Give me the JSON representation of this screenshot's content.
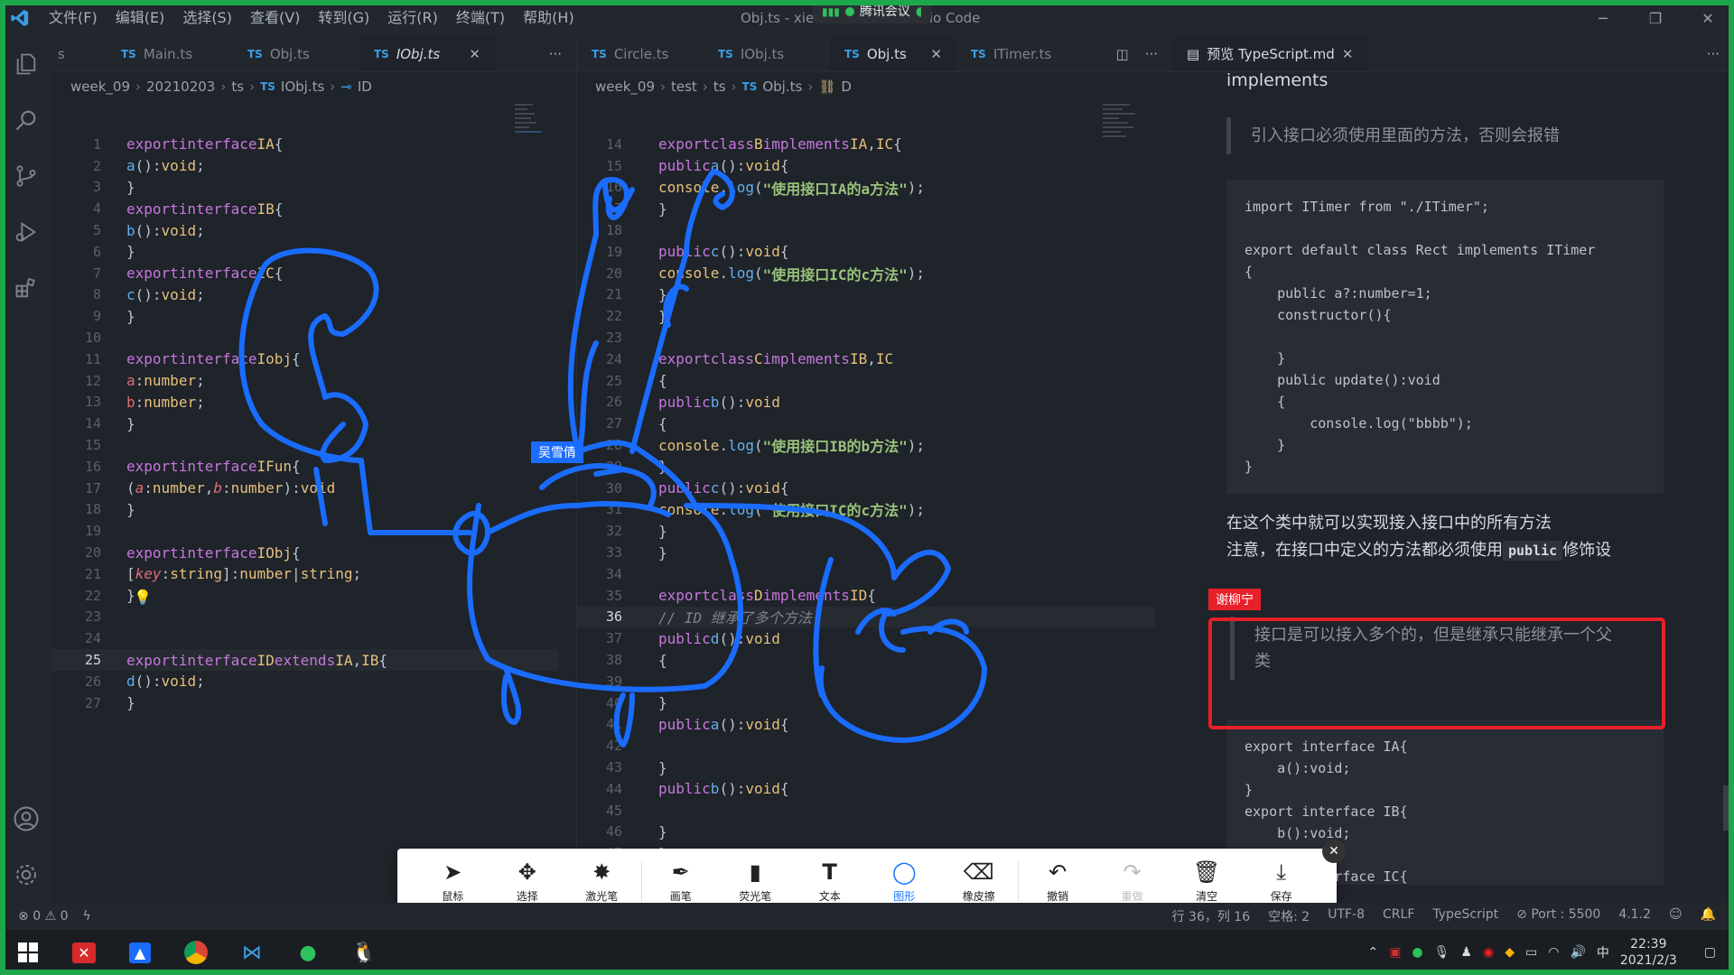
{
  "titlebar": {
    "menu": [
      "文件(F)",
      "编辑(E)",
      "选择(S)",
      "查看(V)",
      "转到(G)",
      "运行(R)",
      "终端(T)",
      "帮助(H)"
    ],
    "title": "Obj.ts - xietian - Visual Studio Code",
    "meeting": "腾讯会议"
  },
  "pane1": {
    "tabs": [
      {
        "label": "Main.ts",
        "active": false
      },
      {
        "label": "Obj.ts",
        "active": false
      },
      {
        "label": "IObj.ts",
        "active": true
      }
    ],
    "crumbs": [
      "week_09",
      "20210203",
      "ts",
      "IObj.ts",
      "ID"
    ],
    "current_line": 25
  },
  "pane2": {
    "tabs": [
      {
        "label": "Circle.ts",
        "active": false
      },
      {
        "label": "IObj.ts",
        "active": false
      },
      {
        "label": "Obj.ts",
        "active": true
      },
      {
        "label": "ITimer.ts",
        "active": false
      }
    ],
    "crumbs": [
      "week_09",
      "test",
      "ts",
      "Obj.ts",
      "D"
    ],
    "current_line": 36
  },
  "preview": {
    "tab_label": "预览 TypeScript.md",
    "heading": "implements",
    "quote1": "引入接口必须使用里面的方法，否则会报错",
    "code1": "import ITimer from \"./ITimer\";\n\nexport default class Rect implements ITimer\n{\n    public a?:number=1;\n    constructor(){\n\n    }\n    public update():void\n    {\n        console.log(\"bbbb\");\n    }\n}",
    "para1": "在这个类中就可以实现接入接口中的所有方法",
    "para2_prefix": "注意，在接口中定义的方法都必须使用",
    "para2_code": "public",
    "para2_suffix": "修饰设",
    "quote2": "接口是可以接入多个的，但是继承只能继承一个父类",
    "code2": "export interface IA{\n    a():void;\n}\nexport interface IB{\n    b():void;\n}\nexport interface IC{"
  },
  "labels": {
    "user1": "吴雪倩",
    "user2": "谢柳宁"
  },
  "toolbar": {
    "tools": [
      {
        "label": "鼠标",
        "icon": "cursor-icon"
      },
      {
        "label": "选择",
        "icon": "move-icon"
      },
      {
        "label": "激光笔",
        "icon": "laser-icon"
      },
      {
        "label": "画笔",
        "icon": "pen-icon"
      },
      {
        "label": "荧光笔",
        "icon": "highlighter-icon"
      },
      {
        "label": "文本",
        "icon": "text-icon"
      },
      {
        "label": "图形",
        "icon": "shape-icon"
      },
      {
        "label": "橡皮擦",
        "icon": "eraser-icon"
      },
      {
        "label": "撤销",
        "icon": "undo-icon"
      },
      {
        "label": "重做",
        "icon": "redo-icon"
      },
      {
        "label": "清空",
        "icon": "trash-icon"
      },
      {
        "label": "保存",
        "icon": "download-icon"
      }
    ]
  },
  "statusbar": {
    "errors": "0",
    "warnings": "0",
    "position": "行 36，列 16",
    "spaces": "空格: 2",
    "encoding": "UTF-8",
    "eol": "CRLF",
    "language": "TypeScript",
    "port": "Port : 5500",
    "version": "4.1.2"
  },
  "taskbar": {
    "time": "22:39",
    "date": "2021/2/3",
    "ime": "中"
  },
  "colors": {
    "accent_green": "#1ca84a",
    "drawing_blue": "#1a6cff",
    "highlight_red": "#e8202a"
  }
}
